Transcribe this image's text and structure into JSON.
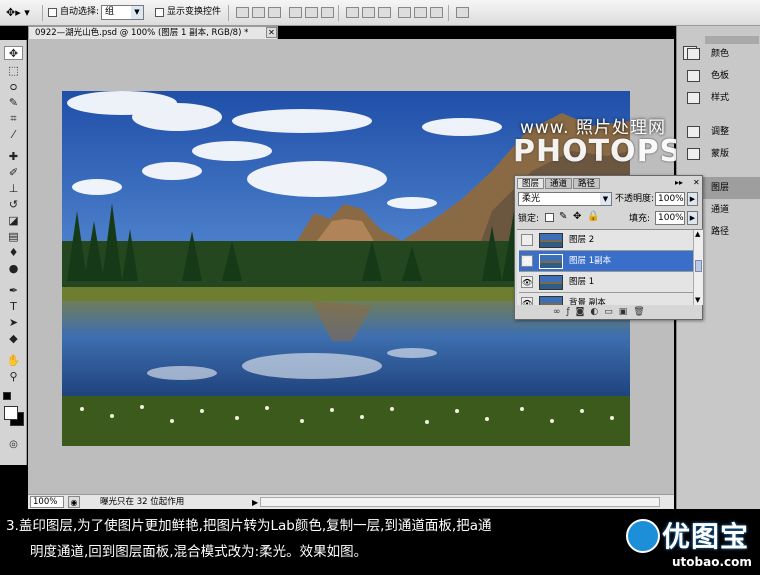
{
  "options_bar": {
    "auto_select_label": "自动选择:",
    "auto_select_value": "组",
    "show_transform_label": "显示变换控件"
  },
  "document": {
    "tab_title": "0922—湖光山色.psd @ 100% (图层 1 副本, RGB/8) *",
    "zoom": "100%",
    "status_text": "曝光只在 32 位起作用"
  },
  "watermark": {
    "line1": "www. 照片处理网",
    "line2": "PHOTOPS.COM"
  },
  "dock": {
    "items": [
      "颜色",
      "色板",
      "样式",
      "调整",
      "蒙版",
      "图层",
      "通道",
      "路径"
    ]
  },
  "layers_panel": {
    "tabs": [
      "图层",
      "通道",
      "路径"
    ],
    "blend_mode": "柔光",
    "opacity_label": "不透明度:",
    "opacity_value": "100%",
    "lock_label": "锁定:",
    "fill_label": "填充:",
    "fill_value": "100%",
    "layers": [
      {
        "name": "图层 2",
        "visible": false,
        "selected": false
      },
      {
        "name": "图层 1副本",
        "visible": true,
        "selected": true
      },
      {
        "name": "图层 1",
        "visible": true,
        "selected": false
      },
      {
        "name": "背景 副本",
        "visible": true,
        "selected": false
      }
    ]
  },
  "caption": {
    "line1": "3.盖印图层,为了使图片更加鲜艳,把图片转为Lab颜色,复制一层,到通道面板,把a通",
    "line2": "明度通道,回到图层面板,混合模式改为:柔光。效果如图。"
  },
  "logo": {
    "text_cn": "优图宝",
    "text_en": "utobao.com"
  },
  "colors": {
    "selection": "#3a6fc9",
    "panel_bg": "#d6d6d6",
    "canvas_bg": "#bdbdbd"
  }
}
